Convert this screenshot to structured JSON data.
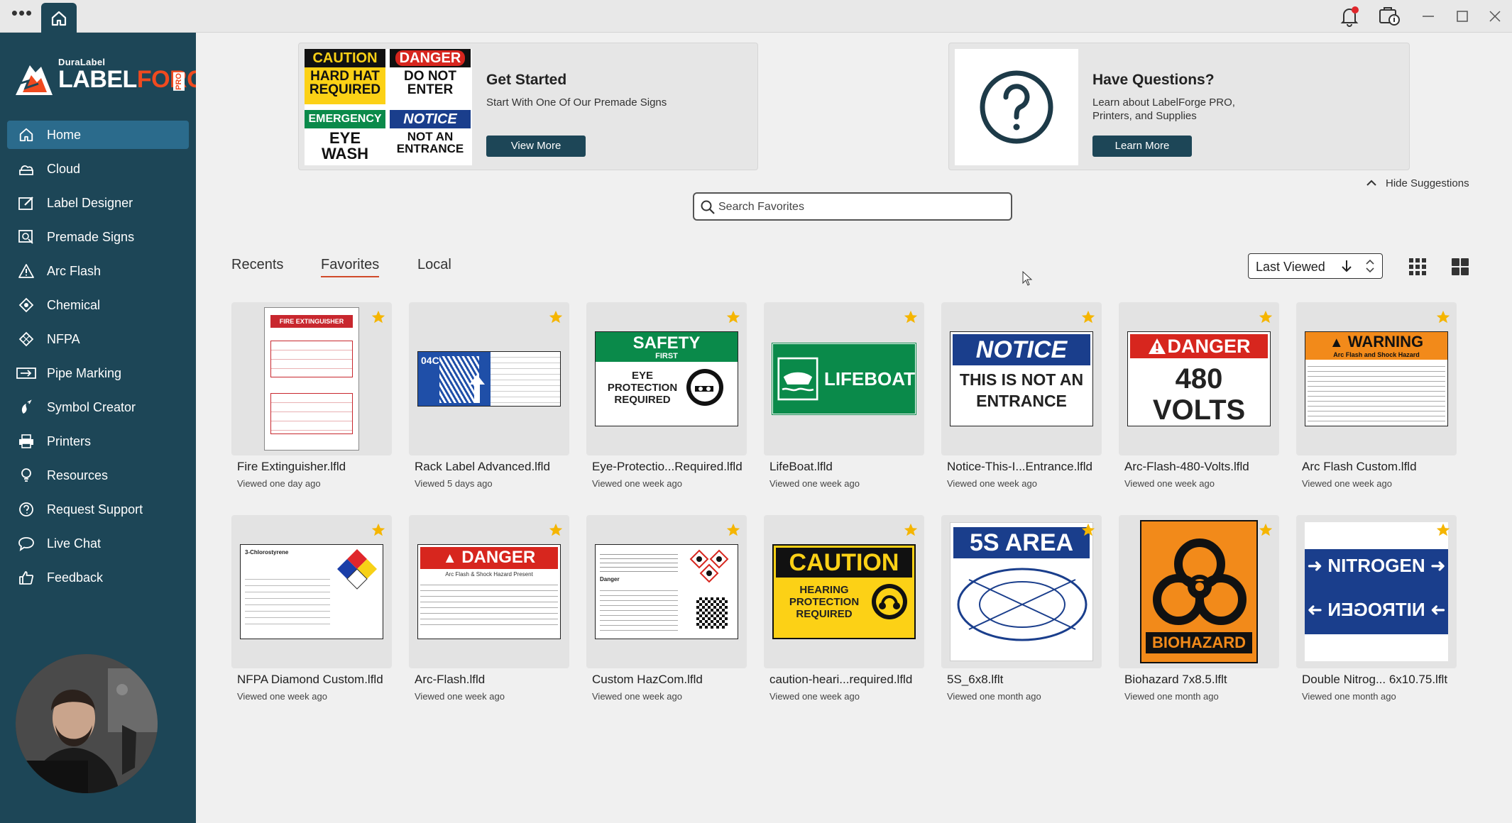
{
  "app": {
    "brand_small": "DuraLabel",
    "brand_main_a": "LABEL",
    "brand_main_b": "FORGE",
    "brand_pro": "PRO"
  },
  "sidebar": {
    "items": [
      {
        "label": "Home",
        "icon": "home-icon",
        "active": true
      },
      {
        "label": "Cloud",
        "icon": "cloud-icon"
      },
      {
        "label": "Label Designer",
        "icon": "label-designer-icon"
      },
      {
        "label": "Premade Signs",
        "icon": "premade-signs-icon"
      },
      {
        "label": "Arc Flash",
        "icon": "warning-triangle-icon"
      },
      {
        "label": "Chemical",
        "icon": "chemical-icon"
      },
      {
        "label": "NFPA",
        "icon": "nfpa-diamond-icon"
      },
      {
        "label": "Pipe Marking",
        "icon": "pipe-marking-icon"
      },
      {
        "label": "Symbol Creator",
        "icon": "symbol-creator-icon"
      },
      {
        "label": "Printers",
        "icon": "printer-icon"
      },
      {
        "label": "Resources",
        "icon": "resources-icon"
      },
      {
        "label": "Request Support",
        "icon": "help-icon"
      },
      {
        "label": "Live Chat",
        "icon": "chat-icon"
      },
      {
        "label": "Feedback",
        "icon": "thumbs-up-icon"
      }
    ]
  },
  "promo_left": {
    "signs": [
      {
        "header": "CAUTION",
        "body": "HARD HAT REQUIRED"
      },
      {
        "header": "DANGER",
        "body": "DO NOT ENTER"
      },
      {
        "header": "EMERGENCY",
        "body": "EYE WASH"
      },
      {
        "header": "NOTICE",
        "body": "NOT AN ENTRANCE"
      }
    ],
    "title": "Get Started",
    "text": "Start With One Of Our Premade Signs",
    "button": "View More"
  },
  "promo_right": {
    "title": "Have Questions?",
    "text_line1": "Learn about LabelForge PRO,",
    "text_line2": "Printers, and Supplies",
    "button": "Learn More"
  },
  "hide_suggestions": "Hide Suggestions",
  "search": {
    "placeholder": "Search Favorites"
  },
  "tabs": [
    {
      "label": "Recents"
    },
    {
      "label": "Favorites",
      "active": true
    },
    {
      "label": "Local"
    }
  ],
  "sort": {
    "label": "Last Viewed"
  },
  "files": [
    {
      "name": "Fire Extinguisher.lfld",
      "viewed": "Viewed one day ago",
      "thumb_text": "FIRE EXTINGUISHER"
    },
    {
      "name": "Rack Label Advanced.lfld",
      "viewed": "Viewed 5 days ago",
      "thumb_text": "04C"
    },
    {
      "name": "Eye-Protectio...Required.lfld",
      "viewed": "Viewed one week ago",
      "thumb_text": "SAFETY",
      "thumb_sub": "FIRST",
      "thumb_body": "EYE PROTECTION REQUIRED"
    },
    {
      "name": "LifeBoat.lfld",
      "viewed": "Viewed one week ago",
      "thumb_text": "LIFEBOAT"
    },
    {
      "name": "Notice-This-I...Entrance.lfld",
      "viewed": "Viewed one week ago",
      "thumb_text": "NOTICE",
      "thumb_body": "THIS IS NOT AN ENTRANCE"
    },
    {
      "name": "Arc-Flash-480-Volts.lfld",
      "viewed": "Viewed one week ago",
      "thumb_text": "DANGER",
      "thumb_body": "480 VOLTS"
    },
    {
      "name": "Arc Flash Custom.lfld",
      "viewed": "Viewed one week ago",
      "thumb_text": "WARNING",
      "thumb_sub": "Arc Flash and Shock Hazard"
    },
    {
      "name": "NFPA Diamond Custom.lfld",
      "viewed": "Viewed one week ago",
      "thumb_text": "3-Chlorostyrene"
    },
    {
      "name": "Arc-Flash.lfld",
      "viewed": "Viewed one week ago",
      "thumb_text": "DANGER",
      "thumb_sub": "Arc Flash & Shock Hazard Present"
    },
    {
      "name": "Custom HazCom.lfld",
      "viewed": "Viewed one week ago",
      "thumb_text": "Danger"
    },
    {
      "name": "caution-heari...required.lfld",
      "viewed": "Viewed one week ago",
      "thumb_text": "CAUTION",
      "thumb_body": "HEARING PROTECTION REQUIRED"
    },
    {
      "name": "5S_6x8.lflt",
      "viewed": "Viewed one month ago",
      "thumb_text": "5S AREA"
    },
    {
      "name": "Biohazard 7x8.5.lflt",
      "viewed": "Viewed one month ago",
      "thumb_text": "BIOHAZARD"
    },
    {
      "name": "Double Nitrog... 6x10.75.lflt",
      "viewed": "Viewed one month ago",
      "thumb_text": "NITROGEN"
    }
  ],
  "colors": {
    "sidebar": "#1d4657",
    "active_nav": "#2b6b8c",
    "accent": "#d14b2a",
    "star": "#f5b500"
  }
}
